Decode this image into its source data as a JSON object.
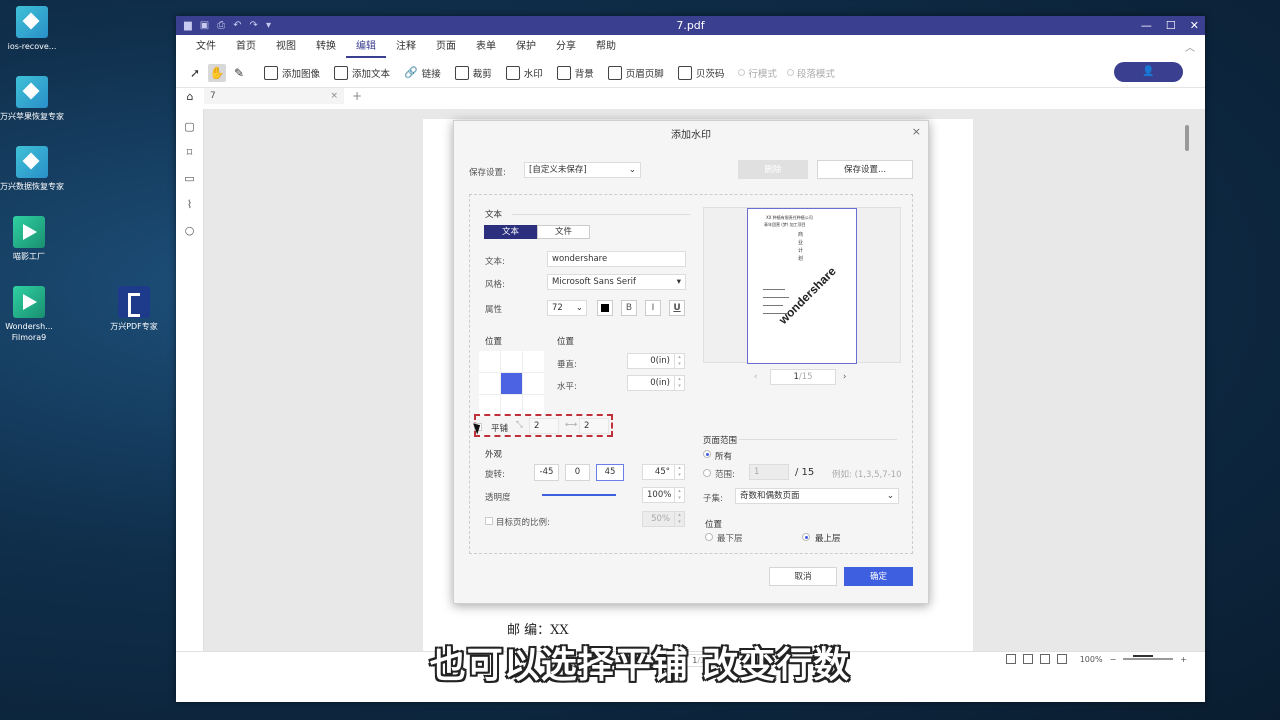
{
  "desktop": {
    "icons": [
      {
        "label": "ios-recove...",
        "color": "teal"
      },
      {
        "label": "万兴苹果恢复专家",
        "color": "teal"
      },
      {
        "label": "万兴数据恢复专家",
        "color": "teal"
      },
      {
        "label": "喵影工厂",
        "color": "green"
      },
      {
        "label": "Wondersh... Filmora9",
        "color": "green"
      },
      {
        "label": "万兴PDF专家",
        "color": "pdf"
      }
    ]
  },
  "window": {
    "title": "7.pdf",
    "controls": {
      "minimize": "—",
      "maximize": "☐",
      "close": "✕"
    }
  },
  "menu": {
    "items": [
      "文件",
      "首页",
      "视图",
      "转换",
      "编辑",
      "注释",
      "页面",
      "表单",
      "保护",
      "分享",
      "帮助"
    ],
    "active": "编辑"
  },
  "toolbar": {
    "add_image": "添加图像",
    "add_text": "添加文本",
    "link": "链接",
    "crop": "裁剪",
    "watermark": "水印",
    "background": "背景",
    "header_footer": "页眉页脚",
    "bates": "贝茨码",
    "line_mode": "行模式",
    "paragraph_mode": "段落模式",
    "user_icon": "👤"
  },
  "tabs": {
    "doc_tab": "7",
    "close": "×",
    "add": "+"
  },
  "page": {
    "mail_line": "邮  编：XX"
  },
  "statusbar": {
    "page_input": "1",
    "page_total": "/15",
    "zoom": "100%"
  },
  "dialog": {
    "title": "添加水印",
    "close": "×",
    "save_settings_label": "保存设置:",
    "save_settings_value": "[自定义未保存]",
    "delete_btn": "删除",
    "save_settings_btn": "保存设置...",
    "text_section": "文本",
    "seg_text": "文本",
    "seg_file": "文件",
    "text_label": "文本:",
    "text_value": "wondershare",
    "style_label": "风格:",
    "style_value": "Microsoft Sans Serif",
    "attr_label": "属性",
    "font_size": "72",
    "bold": "B",
    "italic": "I",
    "underline": "U",
    "position_label": "位置",
    "position_label2": "位置",
    "vertical_label": "垂直:",
    "vertical_value": "0",
    "vertical_unit": "(in)",
    "horizontal_label": "水平:",
    "horizontal_value": "0",
    "horizontal_unit": "(in)",
    "tile_label": "平铺",
    "tile_rows": "2",
    "tile_cols": "2",
    "appearance_section": "外观",
    "rotation_label": "旋转:",
    "rot_neg45": "-45",
    "rot_0": "0",
    "rot_45": "45",
    "rot_value": "45",
    "rot_unit": "°",
    "opacity_label": "透明度",
    "opacity_value": "100",
    "opacity_unit": "%",
    "opacity_fraction": 1.0,
    "target_scale_label": "目标页的比例:",
    "target_scale_value": "50",
    "target_scale_unit": "%",
    "preview_page": "1",
    "preview_total": "/15",
    "preview_wm": "wondershare",
    "preview_title1": "XX 种植有限责任种植公司",
    "preview_title2": "青年团营 (梦) 加工项目",
    "preview_vertical": "商 业 计 划",
    "page_range_section": "页面范围",
    "all_label": "所有",
    "range_label": "范围:",
    "range_value": "1",
    "range_total": "/ 15",
    "range_example": "例如: (1,3,5,7-10)",
    "subset_label": "子集:",
    "subset_value": "奇数和偶数页面",
    "layer_section": "位置",
    "bottom_layer": "最下层",
    "top_layer": "最上层",
    "cancel": "取消",
    "ok": "确定"
  },
  "caption": "也可以选择平铺 改变行数",
  "colors": {
    "titlebar": "#3a3f8f",
    "primary": "#3e5fe0",
    "highlight": "#c0303a"
  }
}
